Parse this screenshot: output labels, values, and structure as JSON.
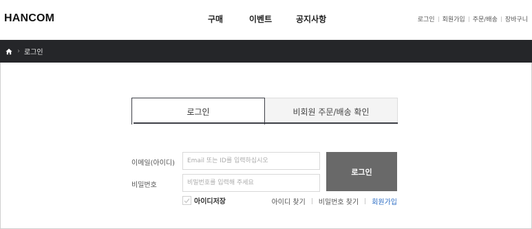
{
  "header": {
    "logo": "HANCOM",
    "nav": [
      "구매",
      "이벤트",
      "공지사항"
    ],
    "util": [
      "로그인",
      "회원가입",
      "주문/배송",
      "장바구니"
    ]
  },
  "breadcrumb": {
    "current": "로그인"
  },
  "tabs": {
    "login": "로그인",
    "guest_order": "비회원 주문/배송 확인"
  },
  "form": {
    "email_label": "이메일(아이디)",
    "email_placeholder": "Email 또는 ID를 입력하십시오",
    "password_label": "비밀번호",
    "password_placeholder": "비밀번호를 입력해 주세요",
    "login_button": "로그인",
    "remember_label": "아이디저장",
    "remember_checked": false,
    "find_id": "아이디 찾기",
    "find_password": "비밀번호 찾기",
    "signup": "회원가입"
  },
  "colors": {
    "brand_red": "#e8262b",
    "dark_bar": "#252629",
    "login_button_bg": "#696969",
    "link_blue": "#2b6cc4"
  },
  "icons": {
    "breadcrumb_home": "home-icon",
    "checkbox": "checkmark-icon"
  }
}
